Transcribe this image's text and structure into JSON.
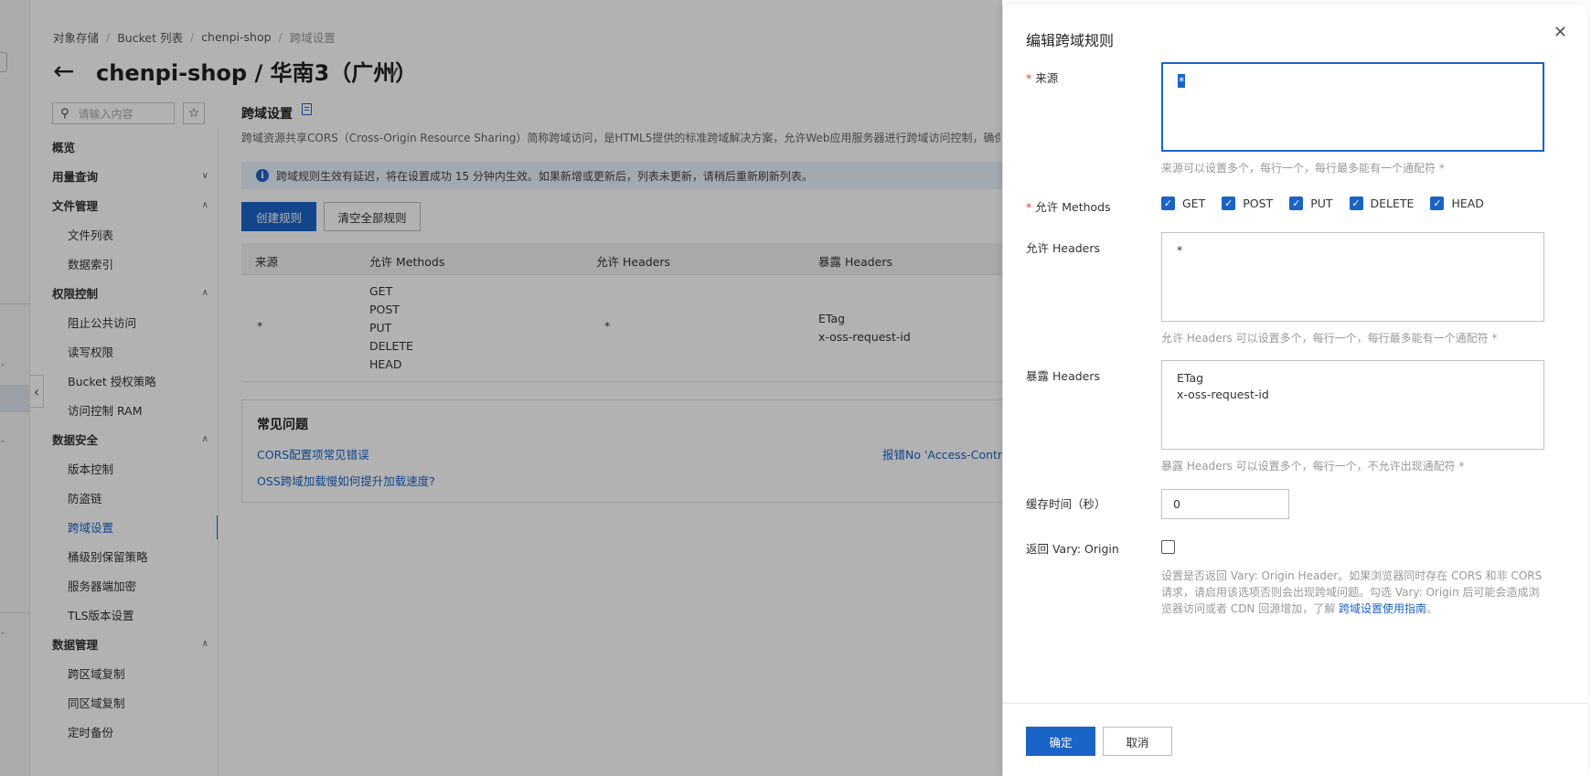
{
  "breadcrumb": [
    "对象存储",
    "Bucket 列表",
    "chenpi-shop",
    "跨域设置"
  ],
  "header": {
    "title": "chenpi-shop / 华南3（广州）"
  },
  "sidebar": {
    "search_placeholder": "请输入内容",
    "items": [
      {
        "label": "概览",
        "type": "group",
        "chevron": ""
      },
      {
        "label": "用量查询",
        "type": "group",
        "chevron": "∨"
      },
      {
        "label": "文件管理",
        "type": "group",
        "chevron": "∧"
      },
      {
        "label": "文件列表",
        "type": "sub"
      },
      {
        "label": "数据索引",
        "type": "sub"
      },
      {
        "label": "权限控制",
        "type": "group",
        "chevron": "∧"
      },
      {
        "label": "阻止公共访问",
        "type": "sub"
      },
      {
        "label": "读写权限",
        "type": "sub"
      },
      {
        "label": "Bucket 授权策略",
        "type": "sub"
      },
      {
        "label": "访问控制 RAM",
        "type": "sub"
      },
      {
        "label": "数据安全",
        "type": "group",
        "chevron": "∧"
      },
      {
        "label": "版本控制",
        "type": "sub"
      },
      {
        "label": "防盗链",
        "type": "sub"
      },
      {
        "label": "跨域设置",
        "type": "sub",
        "active": true
      },
      {
        "label": "桶级别保留策略",
        "type": "sub"
      },
      {
        "label": "服务器端加密",
        "type": "sub"
      },
      {
        "label": "TLS版本设置",
        "type": "sub"
      },
      {
        "label": "数据管理",
        "type": "group",
        "chevron": "∧"
      },
      {
        "label": "跨区域复制",
        "type": "sub"
      },
      {
        "label": "同区域复制",
        "type": "sub"
      },
      {
        "label": "定时备份",
        "type": "sub"
      }
    ]
  },
  "main": {
    "section_title": "跨域设置",
    "description": "跨域资源共享CORS（Cross-Origin Resource Sharing）简称跨域访问，是HTML5提供的标准跨域解决方案，允许Web应用服务器进行跨域访问控制，确保跨",
    "notice": "跨域规则生效有延迟，将在设置成功 15 分钟内生效。如果新增或更新后，列表未更新，请稍后重新刷新列表。",
    "create_button": "创建规则",
    "clear_button": "清空全部规则",
    "table": {
      "columns": [
        "来源",
        "允许 Methods",
        "允许 Headers",
        "暴露 Headers"
      ],
      "rows": [
        {
          "origin": "*",
          "methods": "GET\nPOST\nPUT\nDELETE\nHEAD",
          "allow_headers": "*",
          "expose_headers": "ETag\nx-oss-request-id"
        }
      ]
    },
    "faq": {
      "title": "常见问题",
      "links": [
        "CORS配置项常见错误",
        "OSS跨域加载慢如何提升加载速度?",
        "报错No 'Access-Control"
      ]
    }
  },
  "drawer": {
    "title": "编辑跨域规则",
    "origin_label": "来源",
    "origin_value": "*",
    "origin_hint": "来源可以设置多个，每行一个，每行最多能有一个通配符 *",
    "methods_label": "允许 Methods",
    "methods": [
      {
        "label": "GET",
        "checked": true
      },
      {
        "label": "POST",
        "checked": true
      },
      {
        "label": "PUT",
        "checked": true
      },
      {
        "label": "DELETE",
        "checked": true
      },
      {
        "label": "HEAD",
        "checked": true
      }
    ],
    "allow_headers_label": "允许 Headers",
    "allow_headers_value": "*",
    "allow_headers_hint": "允许 Headers 可以设置多个，每行一个，每行最多能有一个通配符 *",
    "expose_headers_label": "暴露 Headers",
    "expose_headers_value": "ETag\nx-oss-request-id",
    "expose_headers_hint": "暴露 Headers 可以设置多个，每行一个，不允许出现通配符 *",
    "cache_label": "缓存时间（秒）",
    "cache_value": "0",
    "vary_label": "返回 Vary: Origin",
    "vary_checked": false,
    "vary_hint": "设置是否返回 Vary: Origin Header。如果浏览器同时存在 CORS 和非 CORS 请求，请启用该选项否则会出现跨域问题。勾选 Vary: Origin 后可能会造成浏览器访问或者 CDN 回源增加，了解 ",
    "vary_link": "跨域设置使用指南",
    "vary_tail": "。",
    "ok_button": "确定",
    "cancel_button": "取消"
  }
}
